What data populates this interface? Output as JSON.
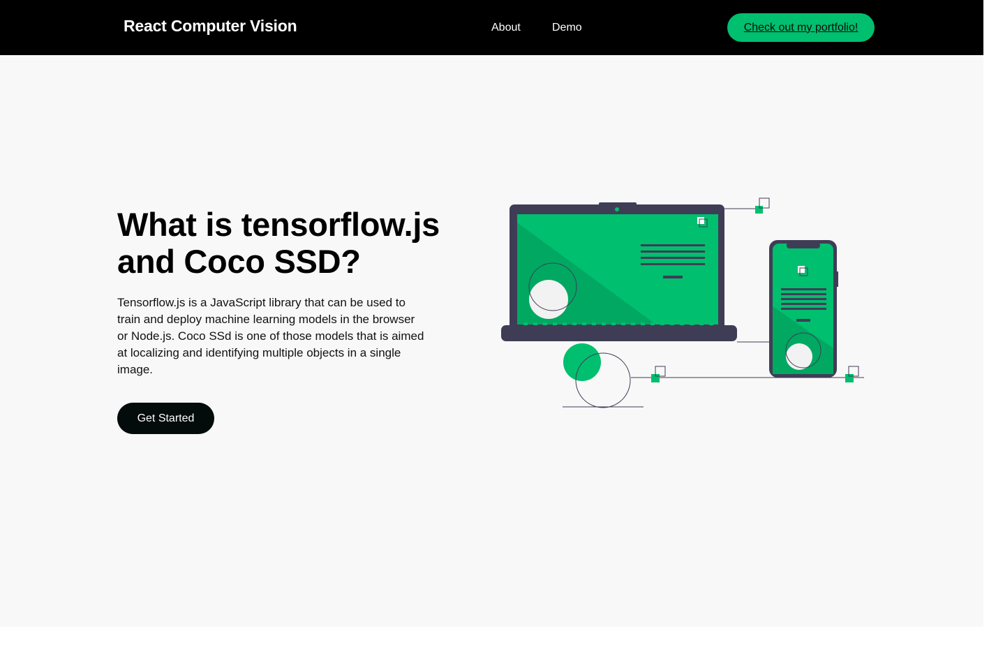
{
  "nav": {
    "brand": "React Computer Vision",
    "links": [
      {
        "label": "About"
      },
      {
        "label": "Demo"
      }
    ],
    "cta_label": "Check out my portfolio!"
  },
  "hero": {
    "title": "What is tensorflow.js and Coco SSD?",
    "description": "Tensorflow.js is a JavaScript library that can be used to train and deploy machine learning models in the browser or Node.js. Coco SSd is one of those models that is aimed at localizing and identifying multiple objects in a single image.",
    "button_label": "Get Started",
    "illustration": "laptop-and-phone-illustration"
  },
  "colors": {
    "accent": "#00bf6f",
    "accent_dark": "#00a862",
    "navbar_bg": "#000000",
    "hero_bg": "#f8f8f8",
    "device_frame": "#3f3d56"
  }
}
